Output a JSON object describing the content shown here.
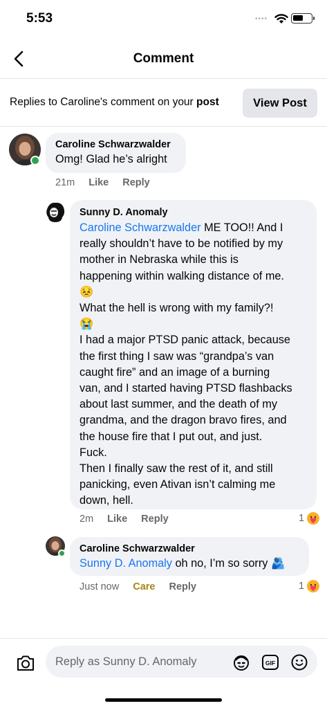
{
  "status_bar": {
    "time": "5:53",
    "dots": "••••"
  },
  "nav": {
    "title": "Comment"
  },
  "context": {
    "prefix": "Replies to Caroline's comment on your ",
    "post_word": "post",
    "view_post_label": "View Post"
  },
  "comments": [
    {
      "author": "Caroline Schwarzwalder",
      "text": "Omg! Glad he’s alright",
      "time": "21m",
      "like": "Like",
      "reply": "Reply"
    },
    {
      "author": "Sunny D. Anomaly",
      "mention": "Caroline Schwarzwalder",
      "lines": [
        " ME TOO!! And I",
        "really shouldn’t have to be notified by my",
        "mother in Nebraska while this is",
        "happening within walking distance of me.",
        "😣",
        "What the hell is wrong with my family?!",
        "😭",
        "I had a major PTSD panic attack, because",
        "the first thing I saw was “grandpa’s van",
        "caught fire” and an image of a burning",
        "van, and I started having PTSD flashbacks",
        "about last summer, and the death of my",
        "grandma, and the dragon bravo fires, and",
        "the house fire that I put out, and just.",
        "Fuck.",
        "Then I finally saw the rest of it, and still",
        "panicking, even Ativan isn’t calming me",
        "down, hell."
      ],
      "time": "2m",
      "like": "Like",
      "reply": "Reply",
      "reaction_count": "1",
      "reaction_icon": "care-emoji-icon"
    },
    {
      "author": "Caroline Schwarzwalder",
      "mention": "Sunny D. Anomaly",
      "text": " oh no, I’m so sorry",
      "emoji": "🫂",
      "time": "Just now",
      "reaction_label": "Care",
      "reply": "Reply",
      "reaction_count": "1",
      "reaction_icon": "care-emoji-icon"
    }
  ],
  "composer": {
    "placeholder": "Reply as Sunny D. Anomaly"
  },
  "colors": {
    "mention": "#1877f2",
    "care": "#a98514",
    "online": "#31a24c",
    "bubble": "#f0f2f5"
  }
}
